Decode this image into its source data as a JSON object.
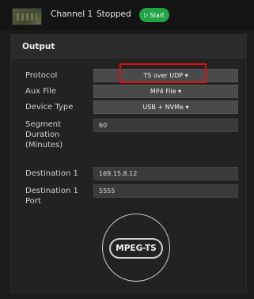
{
  "topbar": {
    "channel_label": "Channel 1",
    "status_label": "Stopped",
    "start_label": "Start"
  },
  "panel": {
    "title": "Output",
    "protocol": {
      "label": "Protocol",
      "value": "TS over UDP ▾"
    },
    "aux_file": {
      "label": "Aux File",
      "value": "MP4 File ▾"
    },
    "device_type": {
      "label": "Device Type",
      "value": "USB + NVMe ▾"
    },
    "segment_duration": {
      "label_line1": "Segment",
      "label_line2": "Duration",
      "label_line3": "(Minutes)",
      "value": "60"
    },
    "destination": {
      "label": "Destination 1",
      "value": "169.15.8.12"
    },
    "destination_port": {
      "label_line1": "Destination 1",
      "label_line2": "Port",
      "value": "5555"
    },
    "format_logo": "MPEG-TS"
  },
  "colors": {
    "background": "#1b1b1b",
    "panel": "#222222",
    "start_button": "#22a545",
    "highlight": "#e01010"
  },
  "icons": {
    "thumbnail": "video-thumbnail",
    "start": "play-icon"
  }
}
